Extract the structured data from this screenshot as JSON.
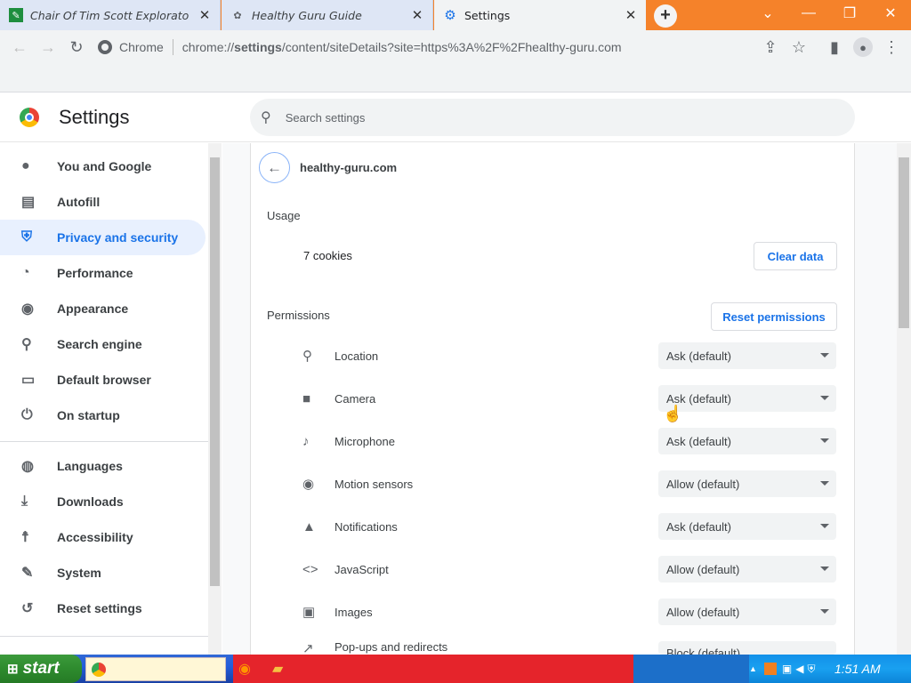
{
  "tabs": [
    {
      "title": "Chair Of Tim Scott Explorato",
      "icon": "document-icon"
    },
    {
      "title": "Healthy Guru Guide",
      "icon": "site-icon"
    },
    {
      "title": "Settings",
      "icon": "gear-icon"
    }
  ],
  "window": {
    "minimize": "—",
    "restore": "❐",
    "close": "✕",
    "chevron": "⌄"
  },
  "omnibox": {
    "label": "Chrome",
    "url_host": "settings",
    "url_prefix": "chrome://",
    "url_rest": "/content/siteDetails?site=https%3A%2F%2Fhealthy-guru.com"
  },
  "header": {
    "title": "Settings",
    "search_placeholder": "Search settings"
  },
  "sidebar": {
    "items": [
      {
        "label": "You and Google",
        "icon": "person-icon"
      },
      {
        "label": "Autofill",
        "icon": "clipboard-icon"
      },
      {
        "label": "Privacy and security",
        "icon": "shield-icon"
      },
      {
        "label": "Performance",
        "icon": "speedometer-icon"
      },
      {
        "label": "Appearance",
        "icon": "palette-icon"
      },
      {
        "label": "Search engine",
        "icon": "search-icon"
      },
      {
        "label": "Default browser",
        "icon": "browser-icon"
      },
      {
        "label": "On startup",
        "icon": "power-icon"
      },
      {
        "label": "Languages",
        "icon": "globe-icon"
      },
      {
        "label": "Downloads",
        "icon": "download-icon"
      },
      {
        "label": "Accessibility",
        "icon": "accessibility-icon"
      },
      {
        "label": "System",
        "icon": "wrench-icon"
      },
      {
        "label": "Reset settings",
        "icon": "history-icon"
      }
    ]
  },
  "site": {
    "name": "healthy-guru.com",
    "usage_label": "Usage",
    "cookies": "7 cookies",
    "clear_data": "Clear data",
    "permissions_label": "Permissions",
    "reset_permissions": "Reset permissions",
    "permissions": [
      {
        "name": "Location",
        "value": "Ask (default)",
        "icon": "location-icon"
      },
      {
        "name": "Camera",
        "value": "Ask (default)",
        "icon": "camera-icon"
      },
      {
        "name": "Microphone",
        "value": "Ask (default)",
        "icon": "microphone-icon"
      },
      {
        "name": "Motion sensors",
        "value": "Allow (default)",
        "icon": "sensors-icon"
      },
      {
        "name": "Notifications",
        "value": "Ask (default)",
        "icon": "bell-icon"
      },
      {
        "name": "JavaScript",
        "value": "Allow (default)",
        "icon": "code-icon"
      },
      {
        "name": "Images",
        "value": "Allow (default)",
        "icon": "image-icon"
      },
      {
        "name": "Pop-ups and redirects",
        "value": "Block (default)",
        "icon": "popup-icon"
      }
    ]
  },
  "taskbar": {
    "start": "start",
    "clock": "1:51 AM"
  }
}
